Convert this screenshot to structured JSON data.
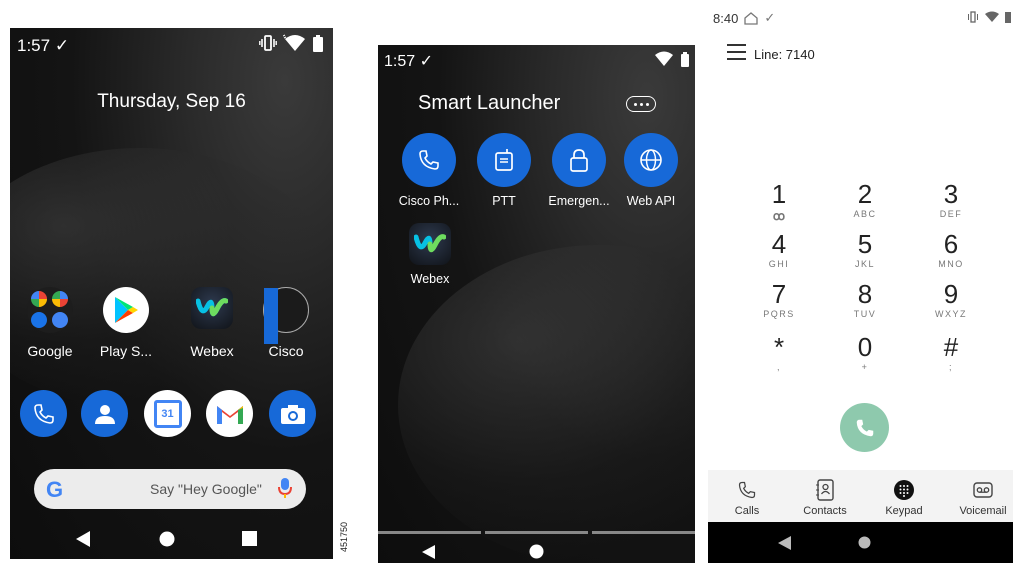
{
  "phone1": {
    "status_time": "1:57",
    "date": "Thursday, Sep 16",
    "apps": [
      {
        "label": "Google"
      },
      {
        "label": "Play S..."
      },
      {
        "label": "Webex"
      },
      {
        "label": "Cisco"
      }
    ],
    "calendar_day": "31",
    "search_placeholder": "Say \"Hey Google\"",
    "google_letter": "G"
  },
  "phone2": {
    "status_time": "1:57",
    "title": "Smart Launcher",
    "apps": [
      {
        "label": "Cisco Ph..."
      },
      {
        "label": "PTT"
      },
      {
        "label": "Emergen..."
      },
      {
        "label": "Web API"
      },
      {
        "label": "Webex"
      }
    ]
  },
  "phone3": {
    "status_time": "8:40",
    "line": "Line: 7140",
    "keys": [
      {
        "num": "1",
        "sub": "ꝏ"
      },
      {
        "num": "2",
        "sub": "ABC"
      },
      {
        "num": "3",
        "sub": "DEF"
      },
      {
        "num": "4",
        "sub": "GHI"
      },
      {
        "num": "5",
        "sub": "JKL"
      },
      {
        "num": "6",
        "sub": "MNO"
      },
      {
        "num": "7",
        "sub": "PQRS"
      },
      {
        "num": "8",
        "sub": "TUV"
      },
      {
        "num": "9",
        "sub": "WXYZ"
      },
      {
        "num": "*",
        "sub": ","
      },
      {
        "num": "0",
        "sub": "+"
      },
      {
        "num": "#",
        "sub": ";"
      }
    ],
    "tabs": [
      {
        "label": "Calls"
      },
      {
        "label": "Contacts"
      },
      {
        "label": "Keypad"
      },
      {
        "label": "Voicemail"
      }
    ],
    "colors": {
      "call_button": "#8ec9ad",
      "tab_bar": "#f3f3f3"
    }
  },
  "figure_id": "451750",
  "colors": {
    "accent_blue": "#1769d8"
  }
}
